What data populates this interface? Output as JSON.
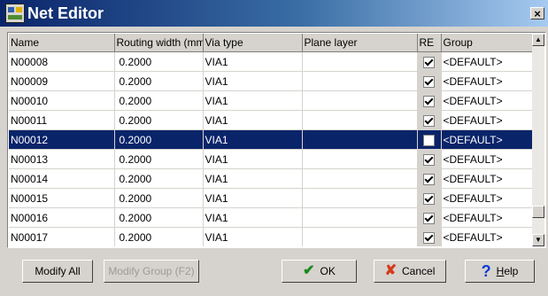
{
  "window": {
    "title": "Net Editor",
    "close_label": "×"
  },
  "table": {
    "columns": [
      "Name",
      "Routing width (mm)",
      "Via type",
      "Plane layer",
      "RE",
      "Group"
    ],
    "rows": [
      {
        "name": "N00008",
        "width": "0.2000",
        "via": "VIA1",
        "plane": "",
        "re": true,
        "group": "<DEFAULT>"
      },
      {
        "name": "N00009",
        "width": "0.2000",
        "via": "VIA1",
        "plane": "",
        "re": true,
        "group": "<DEFAULT>"
      },
      {
        "name": "N00010",
        "width": "0.2000",
        "via": "VIA1",
        "plane": "",
        "re": true,
        "group": "<DEFAULT>"
      },
      {
        "name": "N00011",
        "width": "0.2000",
        "via": "VIA1",
        "plane": "",
        "re": true,
        "group": "<DEFAULT>"
      },
      {
        "name": "N00012",
        "width": "0.2000",
        "via": "VIA1",
        "plane": "",
        "re": false,
        "group": "<DEFAULT>",
        "selected": true
      },
      {
        "name": "N00013",
        "width": "0.2000",
        "via": "VIA1",
        "plane": "",
        "re": true,
        "group": "<DEFAULT>"
      },
      {
        "name": "N00014",
        "width": "0.2000",
        "via": "VIA1",
        "plane": "",
        "re": true,
        "group": "<DEFAULT>"
      },
      {
        "name": "N00015",
        "width": "0.2000",
        "via": "VIA1",
        "plane": "",
        "re": true,
        "group": "<DEFAULT>"
      },
      {
        "name": "N00016",
        "width": "0.2000",
        "via": "VIA1",
        "plane": "",
        "re": true,
        "group": "<DEFAULT>"
      },
      {
        "name": "N00017",
        "width": "0.2000",
        "via": "VIA1",
        "plane": "",
        "re": true,
        "group": "<DEFAULT>"
      }
    ]
  },
  "buttons": {
    "modify_all": "Modify All",
    "modify_group": "Modify Group (F2)",
    "ok": "OK",
    "cancel": "Cancel",
    "help_first": "H",
    "help_rest": "elp"
  },
  "icons": {
    "ok": "check-icon",
    "cancel": "x-icon",
    "help": "question-icon"
  },
  "colors": {
    "title_start": "#0a246a",
    "title_end": "#a6caf0",
    "selection": "#0a246a",
    "face": "#d6d3ce"
  }
}
